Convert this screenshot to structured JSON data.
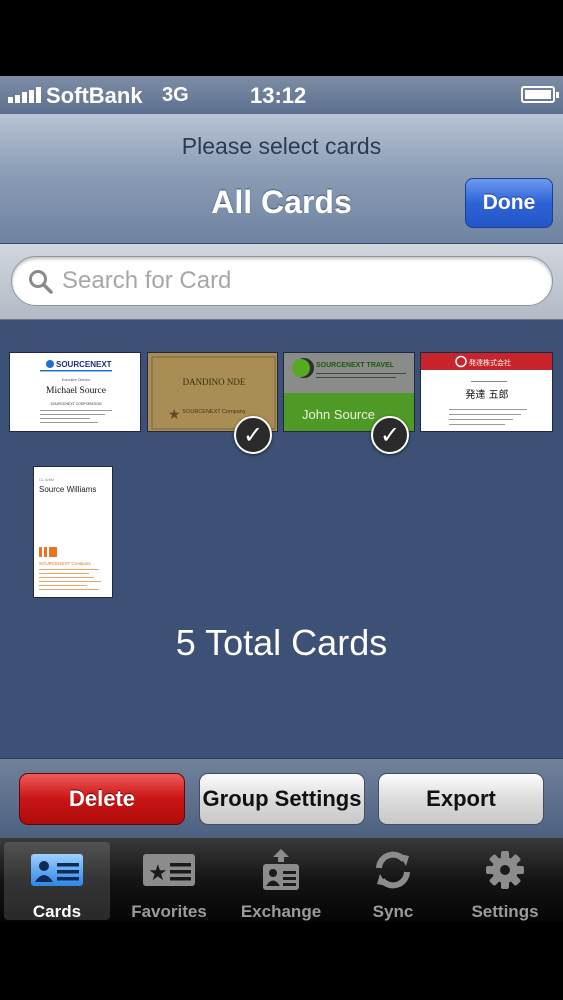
{
  "status_bar": {
    "carrier": "SoftBank",
    "network": "3G",
    "time": "13:12"
  },
  "navbar": {
    "prompt": "Please select cards",
    "title": "All Cards",
    "done_label": "Done"
  },
  "search": {
    "placeholder": "Search for Card"
  },
  "cards": [
    {
      "selected": false,
      "company": "SOURCENEXT",
      "name": "Michael Source",
      "org": "SOURCENEXT CORPORATION"
    },
    {
      "selected": true,
      "name": "DANDINO NDE",
      "org": "SOURCENEXT Company"
    },
    {
      "selected": true,
      "company": "SOURCENEXT TRAVEL",
      "name": "John Source"
    },
    {
      "selected": false,
      "company": "発達株式会社",
      "name": "発達 五郎"
    },
    {
      "selected": false,
      "name": "Source Williams",
      "org": "SOURCENEXT Creations"
    }
  ],
  "total_text": "5 Total Cards",
  "actions": {
    "delete": "Delete",
    "group_settings": "Group Settings",
    "export": "Export"
  },
  "tabs": [
    {
      "label": "Cards",
      "icon": "cards-icon",
      "selected": true
    },
    {
      "label": "Favorites",
      "icon": "favorites-icon",
      "selected": false
    },
    {
      "label": "Exchange",
      "icon": "exchange-icon",
      "selected": false
    },
    {
      "label": "Sync",
      "icon": "sync-icon",
      "selected": false
    },
    {
      "label": "Settings",
      "icon": "settings-icon",
      "selected": false
    }
  ],
  "colors": {
    "background": "#3c5175",
    "done_button": "#2e63d6",
    "delete_button": "#c91414"
  }
}
